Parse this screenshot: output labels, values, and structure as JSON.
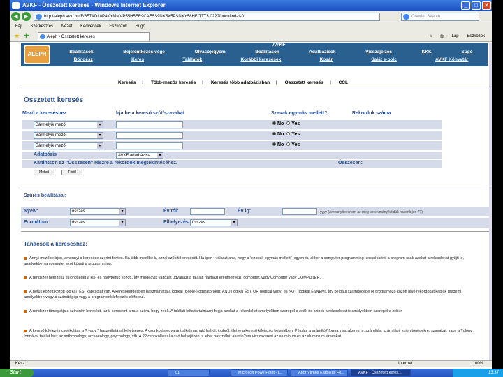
{
  "window": {
    "title": "AVKF - Összetett keresés - Windows Internet Explorer",
    "url": "http://aleph.avkf.hu/F/6F7ADL8P4KYMMVP55H5ER9CAE5S9NX5X5PSNXY58HF-TTT3 022?func=find-d-0",
    "search_placeholder": "Crawler Search",
    "tab_title": "Aleph - Összetett keresés"
  },
  "menubar": [
    "Fájl",
    "Szerkesztés",
    "Nézet",
    "Kedvencek",
    "Eszközök",
    "Súgó"
  ],
  "cmdbar": [
    "Lap",
    "Eszközök"
  ],
  "banner": {
    "logo": "ALEPH",
    "site": "AVKF",
    "nav1": [
      "Beállítások",
      "Bejelentkezés vége",
      "Olvasójegyem",
      "Beállítások",
      "Adatbázisok",
      "Visszajelzés",
      "KKK",
      "Súgó"
    ],
    "nav2": [
      "Böngész",
      "Keres",
      "Találatok",
      "Korábbi keresések",
      "Kosár",
      "Saját e-polc",
      "AVKF Könyvtár"
    ]
  },
  "subnav": [
    "Keresés",
    "Több-mezős keresés",
    "Keresés több adatbázisban",
    "Összetett keresés",
    "CCL"
  ],
  "form": {
    "heading": "Összetett keresés",
    "col_field": "Mező a kereséshez",
    "col_words": "Írja be a kereső szót/szavakat",
    "col_adjacent": "Szavak egymás mellett?",
    "col_records": "Rekordok száma",
    "rows": [
      {
        "field": "Bármelyik mező",
        "no": "No",
        "yes": "Yes"
      },
      {
        "field": "Bármelyik mező",
        "no": "No",
        "yes": "Yes"
      },
      {
        "field": "Bármelyik mező",
        "no": "No",
        "yes": "Yes"
      }
    ],
    "db_label": "Adatbázis",
    "db_value": "AVKF adatbázisa",
    "click_hint": "Kattintson az \"Összesen\" részre a rekordok megtekintéséhez.",
    "total_label": "Összesen:",
    "btn_ok": "Mehet",
    "btn_clear": "Töröl"
  },
  "filters": {
    "heading": "Szűrés beállításai:",
    "lang_label": "Nyelv:",
    "lang_value": "összes",
    "year_from_label": "Év tól:",
    "year_to_label": "Év ig:",
    "year_hint": "yyyy (Amennyiben nem az meg tanenlmány kó'dúk hasonlójon ??)",
    "format_label": "Formátum:",
    "format_value": "összes",
    "location_label": "Elhelyezés:",
    "location_value": "összes"
  },
  "tips": {
    "heading": "Tanácsok a kereséshez:",
    "items": [
      "Annyi mezőbe írjon, amennyi a keresése szerint fontos. Ha több mezőbe ír, azzal szűkíti keresését. Ha igen t választ arra, hogy a \"szavak egymás mellett\" legyenek, akkor a computer programming kereséskénti a program csak azokat a rekordokat gyűjti le, amelyekben a computer szót követi a programming.",
      "A rendszer nem tesz különbséget a kis- és nagybetűk között. Így mindegyik változat ugyanazt a találati halmazt eredményezi: computer, vagy Computer vagy COMPUTER.",
      "A betűk között között log'kai \"ÉS\" kapcsolat van. A keresőkérdésben használhatja a logikai (Boole-) operátorokat: AND (logikai ÉS), OR (logikai vagy) és NOT (logikai ÉSNEM). Így például számítógépe or programozó között lévő rekordokat kapjuk megemi, amelyekben vagy a számítógép vagy a programozó kifejezés előfordul.",
      "A rendszer támogatja a szinonim keresést, tárát keresemt arra a szóra, hogy zeók. A találati leíta tartalmazni fogja azokat a rekordokat amelyekben szerepel a zeók és szinek a rekordokat is amelyekben szerepel a zeber.",
      "A kereső kifejezés csonkolása a ? vagy * használatával lehetséges. A csonkolás egyaránt alkalmazható balról, jobbról, illetve a kereső kifejezés belsejében. Például a számító? forma visszakeresi a: számítás, számítási, számítógépekre, szavakat, vagy a ?ológy formával találat lesz az anthropology, archaeology, psychology, stb. A ?? csonkolással a szó belsejében is lehet használni: alumin?um visszakeresi az aluminum és az aluminium szavakat."
    ]
  },
  "status": {
    "done": "Kész",
    "zone": "Internet",
    "zoom": "100%"
  },
  "taskbar": {
    "start": "Start",
    "tasks": [
      "01",
      "Microsoft PowerPoint - [...",
      "Apor Vilmos Katolikus Fő...",
      "AVKF - Összetett keres..."
    ],
    "clock": "13:37"
  },
  "colors": {
    "accent": "#2a4f8f",
    "banner": "#2a6090",
    "row_bg": "#d5dbe8"
  }
}
